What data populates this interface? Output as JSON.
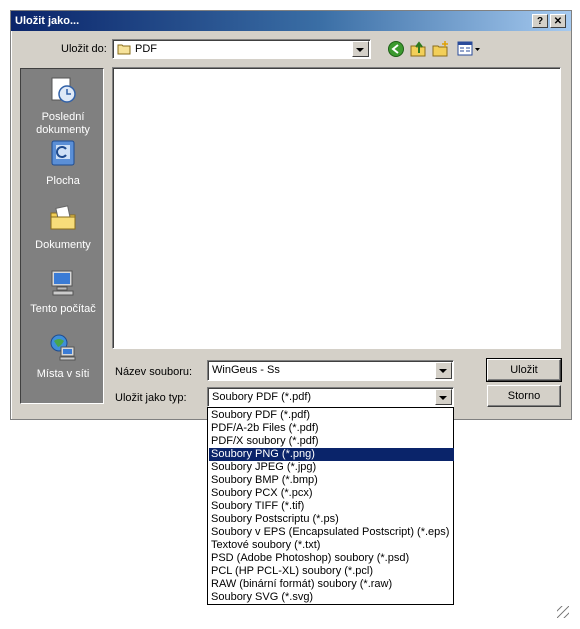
{
  "window": {
    "title": "Uložit jako...",
    "help_label": "?",
    "close_label": "✕"
  },
  "save_in": {
    "label": "Uložit do:",
    "value": "PDF"
  },
  "places": [
    {
      "label": "Poslední\ndokumenty",
      "icon": "recent-documents-icon"
    },
    {
      "label": "Plocha",
      "icon": "desktop-icon"
    },
    {
      "label": "Dokumenty",
      "icon": "my-documents-icon"
    },
    {
      "label": "Tento počítač",
      "icon": "my-computer-icon"
    },
    {
      "label": "Místa v síti",
      "icon": "network-places-icon"
    }
  ],
  "filename": {
    "label": "Název souboru:",
    "value": "WinGeus - Ss"
  },
  "filetype": {
    "label": "Uložit jako typ:",
    "value": "Soubory PDF (*.pdf)",
    "options": [
      "Soubory PDF (*.pdf)",
      "PDF/A-2b Files (*.pdf)",
      "PDF/X soubory (*.pdf)",
      "Soubory PNG (*.png)",
      "Soubory JPEG (*.jpg)",
      "Soubory BMP (*.bmp)",
      "Soubory PCX (*.pcx)",
      "Soubory TIFF (*.tif)",
      "Soubory Postscriptu (*.ps)",
      "Soubory v EPS (Encapsulated Postscript) (*.eps)",
      "Textové soubory (*.txt)",
      "PSD (Adobe Photoshop) soubory (*.psd)",
      "PCL (HP PCL-XL) soubory (*.pcl)",
      "RAW (binární formát) soubory (*.raw)",
      "Soubory SVG (*.svg)"
    ],
    "selected_option": "Soubory PNG (*.png)"
  },
  "buttons": {
    "save": "Uložit",
    "cancel": "Storno"
  },
  "colors": {
    "title_bar": "#0a246a",
    "selection": "#0a246a",
    "dialog_bg": "#d4d0c8"
  }
}
